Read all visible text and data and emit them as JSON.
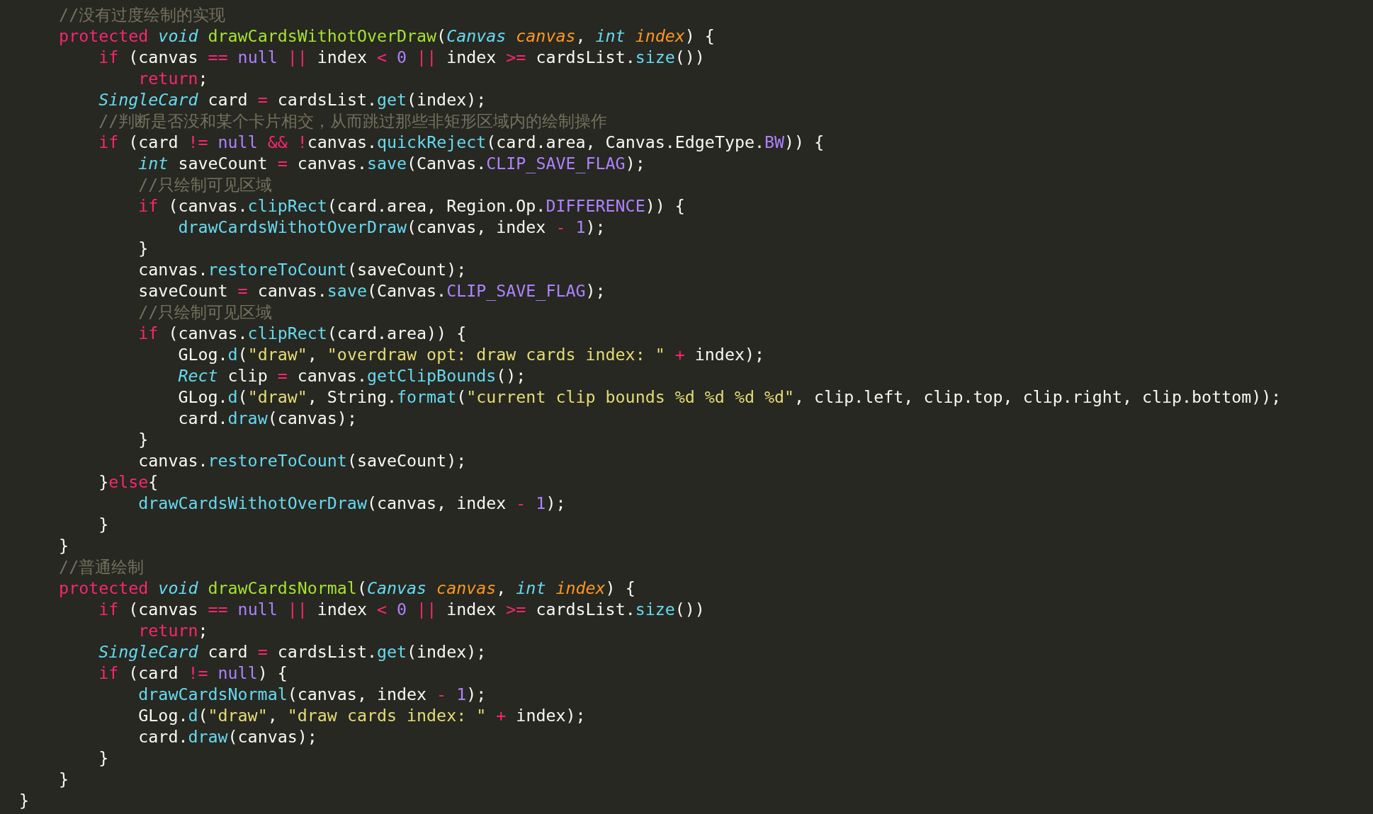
{
  "editor": {
    "lines": [
      [
        {
          "kind": "comment",
          "text": "    //没有过度绘制的实现"
        }
      ],
      [
        {
          "kind": "keyword",
          "text": "    protected"
        },
        {
          "kind": "type",
          "text": " void"
        },
        {
          "kind": "function",
          "text": " drawCardsWithotOverDraw"
        },
        {
          "kind": "plain",
          "text": "("
        },
        {
          "kind": "type",
          "text": "Canvas"
        },
        {
          "kind": "param",
          "text": " canvas"
        },
        {
          "kind": "plain",
          "text": ", "
        },
        {
          "kind": "type",
          "text": "int"
        },
        {
          "kind": "param",
          "text": " index"
        },
        {
          "kind": "plain",
          "text": ") {"
        }
      ],
      [
        {
          "kind": "keyword",
          "text": "        if"
        },
        {
          "kind": "plain",
          "text": " (canvas "
        },
        {
          "kind": "keyword",
          "text": "=="
        },
        {
          "kind": "constant",
          "text": " null"
        },
        {
          "kind": "keyword",
          "text": " ||"
        },
        {
          "kind": "plain",
          "text": " index "
        },
        {
          "kind": "keyword",
          "text": "<"
        },
        {
          "kind": "constant",
          "text": " 0"
        },
        {
          "kind": "keyword",
          "text": " ||"
        },
        {
          "kind": "plain",
          "text": " index "
        },
        {
          "kind": "keyword",
          "text": ">="
        },
        {
          "kind": "plain",
          "text": " cardsList."
        },
        {
          "kind": "call",
          "text": "size"
        },
        {
          "kind": "plain",
          "text": "())"
        }
      ],
      [
        {
          "kind": "keyword",
          "text": "            return"
        },
        {
          "kind": "plain",
          "text": ";"
        }
      ],
      [
        {
          "kind": "type",
          "text": "        SingleCard"
        },
        {
          "kind": "plain",
          "text": " card "
        },
        {
          "kind": "keyword",
          "text": "="
        },
        {
          "kind": "plain",
          "text": " cardsList."
        },
        {
          "kind": "call",
          "text": "get"
        },
        {
          "kind": "plain",
          "text": "(index);"
        }
      ],
      [
        {
          "kind": "comment",
          "text": "        //判断是否没和某个卡片相交，从而跳过那些非矩形区域内的绘制操作"
        }
      ],
      [
        {
          "kind": "keyword",
          "text": "        if"
        },
        {
          "kind": "plain",
          "text": " (card "
        },
        {
          "kind": "keyword",
          "text": "!="
        },
        {
          "kind": "constant",
          "text": " null"
        },
        {
          "kind": "keyword",
          "text": " &&"
        },
        {
          "kind": "keyword",
          "text": " !"
        },
        {
          "kind": "plain",
          "text": "canvas."
        },
        {
          "kind": "call",
          "text": "quickReject"
        },
        {
          "kind": "plain",
          "text": "(card.area, Canvas.EdgeType."
        },
        {
          "kind": "constant",
          "text": "BW"
        },
        {
          "kind": "plain",
          "text": ")) {"
        }
      ],
      [
        {
          "kind": "type",
          "text": "            int"
        },
        {
          "kind": "plain",
          "text": " saveCount "
        },
        {
          "kind": "keyword",
          "text": "="
        },
        {
          "kind": "plain",
          "text": " canvas."
        },
        {
          "kind": "call",
          "text": "save"
        },
        {
          "kind": "plain",
          "text": "(Canvas."
        },
        {
          "kind": "constant",
          "text": "CLIP_SAVE_FLAG"
        },
        {
          "kind": "plain",
          "text": ");"
        }
      ],
      [
        {
          "kind": "comment",
          "text": "            //只绘制可见区域"
        }
      ],
      [
        {
          "kind": "keyword",
          "text": "            if"
        },
        {
          "kind": "plain",
          "text": " (canvas."
        },
        {
          "kind": "call",
          "text": "clipRect"
        },
        {
          "kind": "plain",
          "text": "(card.area, Region.Op."
        },
        {
          "kind": "constant",
          "text": "DIFFERENCE"
        },
        {
          "kind": "plain",
          "text": ")) {"
        }
      ],
      [
        {
          "kind": "call",
          "text": "                drawCardsWithotOverDraw"
        },
        {
          "kind": "plain",
          "text": "(canvas, index "
        },
        {
          "kind": "keyword",
          "text": "-"
        },
        {
          "kind": "constant",
          "text": " 1"
        },
        {
          "kind": "plain",
          "text": ");"
        }
      ],
      [
        {
          "kind": "plain",
          "text": "            }"
        }
      ],
      [
        {
          "kind": "plain",
          "text": "            canvas."
        },
        {
          "kind": "call",
          "text": "restoreToCount"
        },
        {
          "kind": "plain",
          "text": "(saveCount);"
        }
      ],
      [
        {
          "kind": "plain",
          "text": "            saveCount "
        },
        {
          "kind": "keyword",
          "text": "="
        },
        {
          "kind": "plain",
          "text": " canvas."
        },
        {
          "kind": "call",
          "text": "save"
        },
        {
          "kind": "plain",
          "text": "(Canvas."
        },
        {
          "kind": "constant",
          "text": "CLIP_SAVE_FLAG"
        },
        {
          "kind": "plain",
          "text": ");"
        }
      ],
      [
        {
          "kind": "comment",
          "text": "            //只绘制可见区域"
        }
      ],
      [
        {
          "kind": "keyword",
          "text": "            if"
        },
        {
          "kind": "plain",
          "text": " (canvas."
        },
        {
          "kind": "call",
          "text": "clipRect"
        },
        {
          "kind": "plain",
          "text": "(card.area)) {"
        }
      ],
      [
        {
          "kind": "plain",
          "text": "                GLog."
        },
        {
          "kind": "call",
          "text": "d"
        },
        {
          "kind": "plain",
          "text": "("
        },
        {
          "kind": "string",
          "text": "\"draw\""
        },
        {
          "kind": "plain",
          "text": ", "
        },
        {
          "kind": "string",
          "text": "\"overdraw opt: draw cards index: \""
        },
        {
          "kind": "keyword",
          "text": " +"
        },
        {
          "kind": "plain",
          "text": " index);"
        }
      ],
      [
        {
          "kind": "type",
          "text": "                Rect"
        },
        {
          "kind": "plain",
          "text": " clip "
        },
        {
          "kind": "keyword",
          "text": "="
        },
        {
          "kind": "plain",
          "text": " canvas."
        },
        {
          "kind": "call",
          "text": "getClipBounds"
        },
        {
          "kind": "plain",
          "text": "();"
        }
      ],
      [
        {
          "kind": "plain",
          "text": "                GLog."
        },
        {
          "kind": "call",
          "text": "d"
        },
        {
          "kind": "plain",
          "text": "("
        },
        {
          "kind": "string",
          "text": "\"draw\""
        },
        {
          "kind": "plain",
          "text": ", String."
        },
        {
          "kind": "call",
          "text": "format"
        },
        {
          "kind": "plain",
          "text": "("
        },
        {
          "kind": "string",
          "text": "\"current clip bounds %d %d %d %d\""
        },
        {
          "kind": "plain",
          "text": ", clip.left, clip.top, clip.right, clip.bottom));"
        }
      ],
      [
        {
          "kind": "plain",
          "text": "                card."
        },
        {
          "kind": "call",
          "text": "draw"
        },
        {
          "kind": "plain",
          "text": "(canvas);"
        }
      ],
      [
        {
          "kind": "plain",
          "text": "            }"
        }
      ],
      [
        {
          "kind": "plain",
          "text": "            canvas."
        },
        {
          "kind": "call",
          "text": "restoreToCount"
        },
        {
          "kind": "plain",
          "text": "(saveCount);"
        }
      ],
      [
        {
          "kind": "plain",
          "text": "        }"
        },
        {
          "kind": "keyword",
          "text": "else"
        },
        {
          "kind": "plain",
          "text": "{"
        }
      ],
      [
        {
          "kind": "call",
          "text": "            drawCardsWithotOverDraw"
        },
        {
          "kind": "plain",
          "text": "(canvas, index "
        },
        {
          "kind": "keyword",
          "text": "-"
        },
        {
          "kind": "constant",
          "text": " 1"
        },
        {
          "kind": "plain",
          "text": ");"
        }
      ],
      [
        {
          "kind": "plain",
          "text": "        }"
        }
      ],
      [
        {
          "kind": "plain",
          "text": "    }"
        }
      ],
      [
        {
          "kind": "comment",
          "text": "    //普通绘制"
        }
      ],
      [
        {
          "kind": "keyword",
          "text": "    protected"
        },
        {
          "kind": "type",
          "text": " void"
        },
        {
          "kind": "function",
          "text": " drawCardsNormal"
        },
        {
          "kind": "plain",
          "text": "("
        },
        {
          "kind": "type",
          "text": "Canvas"
        },
        {
          "kind": "param",
          "text": " canvas"
        },
        {
          "kind": "plain",
          "text": ", "
        },
        {
          "kind": "type",
          "text": "int"
        },
        {
          "kind": "param",
          "text": " index"
        },
        {
          "kind": "plain",
          "text": ") {"
        }
      ],
      [
        {
          "kind": "keyword",
          "text": "        if"
        },
        {
          "kind": "plain",
          "text": " (canvas "
        },
        {
          "kind": "keyword",
          "text": "=="
        },
        {
          "kind": "constant",
          "text": " null"
        },
        {
          "kind": "keyword",
          "text": " ||"
        },
        {
          "kind": "plain",
          "text": " index "
        },
        {
          "kind": "keyword",
          "text": "<"
        },
        {
          "kind": "constant",
          "text": " 0"
        },
        {
          "kind": "keyword",
          "text": " ||"
        },
        {
          "kind": "plain",
          "text": " index "
        },
        {
          "kind": "keyword",
          "text": ">="
        },
        {
          "kind": "plain",
          "text": " cardsList."
        },
        {
          "kind": "call",
          "text": "size"
        },
        {
          "kind": "plain",
          "text": "())"
        }
      ],
      [
        {
          "kind": "keyword",
          "text": "            return"
        },
        {
          "kind": "plain",
          "text": ";"
        }
      ],
      [
        {
          "kind": "type",
          "text": "        SingleCard"
        },
        {
          "kind": "plain",
          "text": " card "
        },
        {
          "kind": "keyword",
          "text": "="
        },
        {
          "kind": "plain",
          "text": " cardsList."
        },
        {
          "kind": "call",
          "text": "get"
        },
        {
          "kind": "plain",
          "text": "(index);"
        }
      ],
      [
        {
          "kind": "keyword",
          "text": "        if"
        },
        {
          "kind": "plain",
          "text": " (card "
        },
        {
          "kind": "keyword",
          "text": "!="
        },
        {
          "kind": "constant",
          "text": " null"
        },
        {
          "kind": "plain",
          "text": ") {"
        }
      ],
      [
        {
          "kind": "call",
          "text": "            drawCardsNormal"
        },
        {
          "kind": "plain",
          "text": "(canvas, index "
        },
        {
          "kind": "keyword",
          "text": "-"
        },
        {
          "kind": "constant",
          "text": " 1"
        },
        {
          "kind": "plain",
          "text": ");"
        }
      ],
      [
        {
          "kind": "plain",
          "text": "            GLog."
        },
        {
          "kind": "call",
          "text": "d"
        },
        {
          "kind": "plain",
          "text": "("
        },
        {
          "kind": "string",
          "text": "\"draw\""
        },
        {
          "kind": "plain",
          "text": ", "
        },
        {
          "kind": "string",
          "text": "\"draw cards index: \""
        },
        {
          "kind": "keyword",
          "text": " +"
        },
        {
          "kind": "plain",
          "text": " index);"
        }
      ],
      [
        {
          "kind": "plain",
          "text": "            card."
        },
        {
          "kind": "call",
          "text": "draw"
        },
        {
          "kind": "plain",
          "text": "(canvas);"
        }
      ],
      [
        {
          "kind": "plain",
          "text": "        }"
        }
      ],
      [
        {
          "kind": "plain",
          "text": "    }"
        }
      ],
      [
        {
          "kind": "plain",
          "text": "}"
        }
      ]
    ]
  }
}
